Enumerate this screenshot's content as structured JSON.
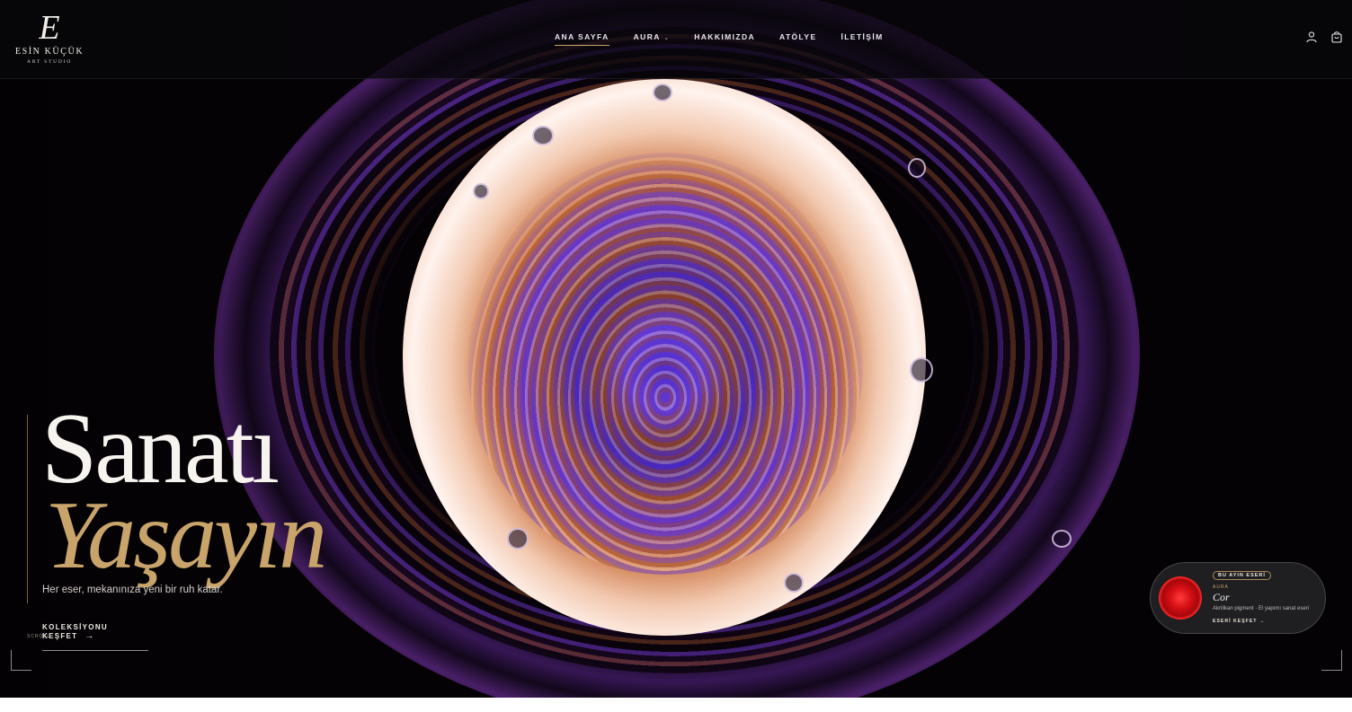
{
  "header": {
    "logo": {
      "mark": "E",
      "name": "ESİN KÜÇÜK",
      "subtitle": "ART STUDIO"
    },
    "nav": [
      {
        "label": "ANA SAYFA",
        "active": true
      },
      {
        "label": "AURA",
        "has_dropdown": true
      },
      {
        "label": "HAKKIMIZDA"
      },
      {
        "label": "ATÖLYE"
      },
      {
        "label": "İLETİŞİM"
      }
    ],
    "icons": [
      "user-icon",
      "shopping-bag-icon"
    ]
  },
  "hero": {
    "title_line1": "Sanatı",
    "title_line2": "Yaşayın",
    "subtitle": "Her eser, mekanınıza yeni bir ruh katar.",
    "cta_label": "KOLEKSİYONU KEŞFET",
    "cta_arrow": "→",
    "scroll_label": "SCROLL"
  },
  "featured": {
    "badge": "BU AYIN ESERİ",
    "category": "AURA",
    "title": "Cor",
    "description": "Akrilikan pigment · El yapımı sanat eseri",
    "link_label": "ESERİ KEŞFET",
    "link_arrow": "→"
  },
  "colors": {
    "accent_gold": "#c9a46a",
    "header_bg": "#08060a",
    "text_light": "#f7f4ef"
  }
}
